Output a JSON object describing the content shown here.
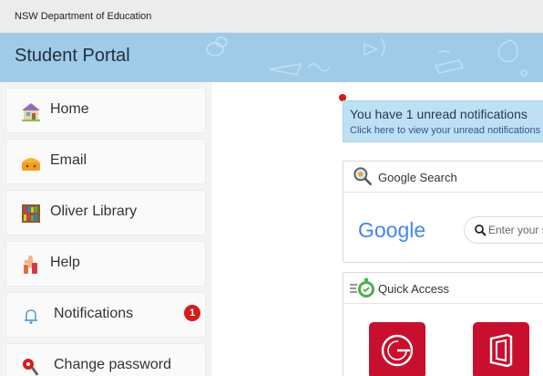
{
  "header": {
    "organization": "NSW Department of Education"
  },
  "banner": {
    "title": "Student Portal",
    "color": "#9fcbe8"
  },
  "sidebar": {
    "items": [
      {
        "label": "Home",
        "icon": "house-icon"
      },
      {
        "label": "Email",
        "icon": "mail-icon"
      },
      {
        "label": "Oliver Library",
        "icon": "bookshelf-icon"
      },
      {
        "label": "Help",
        "icon": "raised-hand-icon"
      },
      {
        "label": "Notifications",
        "icon": "bell-icon",
        "badge": "1"
      },
      {
        "label": "Change password",
        "icon": "key-icon"
      }
    ]
  },
  "notice": {
    "main": "You have 1 unread notifications",
    "sub": "Click here to view your unread notifications"
  },
  "google_card": {
    "title": "Google Search",
    "logo_text": "Google",
    "search_placeholder": "Enter your search"
  },
  "quick_access": {
    "title": "Quick Access",
    "tiles": [
      {
        "icon": "google-g-icon"
      },
      {
        "icon": "office-icon"
      }
    ]
  },
  "colors": {
    "accent_red": "#c8102e",
    "badge_red": "#d51c1c",
    "notice_bg": "#bfe0f3"
  }
}
